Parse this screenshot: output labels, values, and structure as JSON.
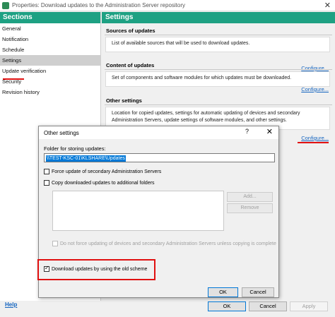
{
  "window": {
    "title": "Properties: Download updates to the Administration Server repository",
    "close_glyph": "✕"
  },
  "sections": {
    "header": "Sections",
    "items": [
      {
        "label": "General"
      },
      {
        "label": "Notification"
      },
      {
        "label": "Schedule"
      },
      {
        "label": "Settings",
        "selected": true
      },
      {
        "label": "Update verification"
      },
      {
        "label": "Security"
      },
      {
        "label": "Revision history"
      }
    ]
  },
  "settings": {
    "header": "Settings",
    "sources": {
      "title": "Sources of updates",
      "description": "List of available sources that will be used to download updates.",
      "link": "Configure..."
    },
    "content": {
      "title": "Content of updates",
      "description": "Set of components and software modules for which updates must be downloaded.",
      "link": "Configure..."
    },
    "other": {
      "title": "Other settings",
      "description": "Location for copied updates, settings for automatic updating of devices and secondary Administration Servers, update settings of software modules, and other settings.",
      "link": "Configure..."
    }
  },
  "dialog": {
    "title": "Other settings",
    "help_glyph": "?",
    "close_glyph": "✕",
    "folder_label": "Folder for storing updates:",
    "folder_value": "\\\\TEST-KSC-01\\KLSHARE\\Updates",
    "force_update": {
      "label": "Force update of secondary Administration Servers",
      "checked": false
    },
    "copy_downloaded": {
      "label": "Copy downloaded updates to additional folders",
      "checked": false
    },
    "add_button": "Add...",
    "remove_button": "Remove",
    "no_force": {
      "label": "Do not force updating of devices and secondary Administration Servers unless copying is complete",
      "checked": false
    },
    "old_scheme": {
      "label": "Download updates by using the old scheme",
      "checked": true
    },
    "ok_button": "OK",
    "cancel_button": "Cancel"
  },
  "footer": {
    "help": "Help",
    "ok_button": "OK",
    "cancel_button": "Cancel",
    "apply_button": "Apply"
  },
  "colors": {
    "accent": "#1ea183",
    "link": "#1565c0",
    "highlight": "#e01010"
  }
}
